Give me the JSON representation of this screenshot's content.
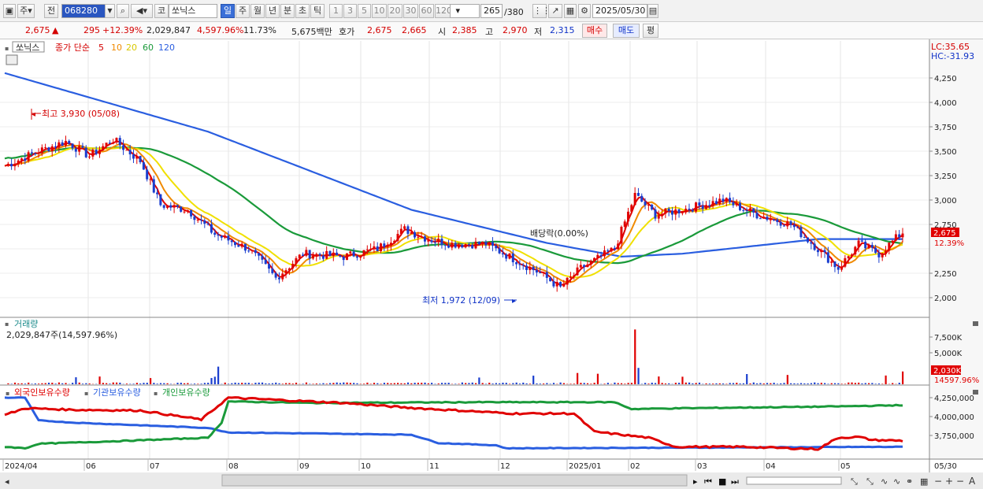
{
  "toolbar": {
    "market_label": "주",
    "prev_label": "전",
    "code": "068280",
    "code_type": "코",
    "stock_name": "쏘닉스",
    "periods": [
      "일",
      "주",
      "월",
      "년",
      "분",
      "초",
      "틱"
    ],
    "active_period": "일",
    "ranges": [
      "1",
      "3",
      "5",
      "10",
      "20",
      "30",
      "60",
      "120"
    ],
    "count": "265",
    "count_total": "/380",
    "date": "2025/05/30"
  },
  "quote": {
    "price": "2,675",
    "change": "295",
    "change_pct": "+12.39%",
    "volume": "2,029,847",
    "volume_ratio": "4,597.96%",
    "turnover": "11.73%",
    "amount": "5,675백만",
    "bid_label": "호가",
    "ask": "2,675",
    "bid": "2,665",
    "open_label": "시",
    "open": "2,385",
    "high_label": "고",
    "high": "2,970",
    "low_label": "저",
    "low": "2,315",
    "buy_btn": "매수",
    "sell_btn": "매도",
    "eval_btn": "평"
  },
  "price_panel": {
    "legend_name": "쏘닉스",
    "legend_items": [
      "종가 단순",
      "5",
      "10",
      "20",
      "60",
      "120"
    ],
    "lc_label": "LC:35.65",
    "hc_label": "HC:-31.93",
    "max_label": "최고 3,930 (05/08)",
    "min_label": "최저 1,972 (12/09)",
    "dividend_label": "배당락(0.00%)",
    "last_price_tag": "2,675",
    "last_pct_tag": "12.39%",
    "y_ticks": [
      "4,250",
      "4,000",
      "3,750",
      "3,500",
      "3,250",
      "3,000",
      "2,750",
      "2,500",
      "2,250",
      "2,000"
    ]
  },
  "volume_panel": {
    "title": "거래량",
    "info": "2,029,847주(14,597.96%)",
    "y_ticks": [
      "7,500K",
      "5,000K"
    ],
    "tag_volume": "2,030K",
    "tag_pct": "14597.96%"
  },
  "holding_panel": {
    "legend": [
      "외국인보유수량",
      "기관보유수량",
      "개인보유수량"
    ],
    "y_ticks": [
      "4,250,000",
      "4,000,000",
      "3,750,000"
    ]
  },
  "x_axis": [
    "2024/04",
    "06",
    "07",
    "08",
    "09",
    "10",
    "11",
    "12",
    "2025/01",
    "02",
    "03",
    "04",
    "05",
    "05/30"
  ],
  "colors": {
    "up": "#e00000",
    "down": "#1a3ecf",
    "ma5": "#e00000",
    "ma10": "#f08a00",
    "ma20": "#f0e000",
    "ma60": "#1a9a3a",
    "ma120": "#2a5ee0",
    "foreign": "#e00000",
    "institution": "#2a5ee0",
    "individual": "#1a9a3a"
  }
}
